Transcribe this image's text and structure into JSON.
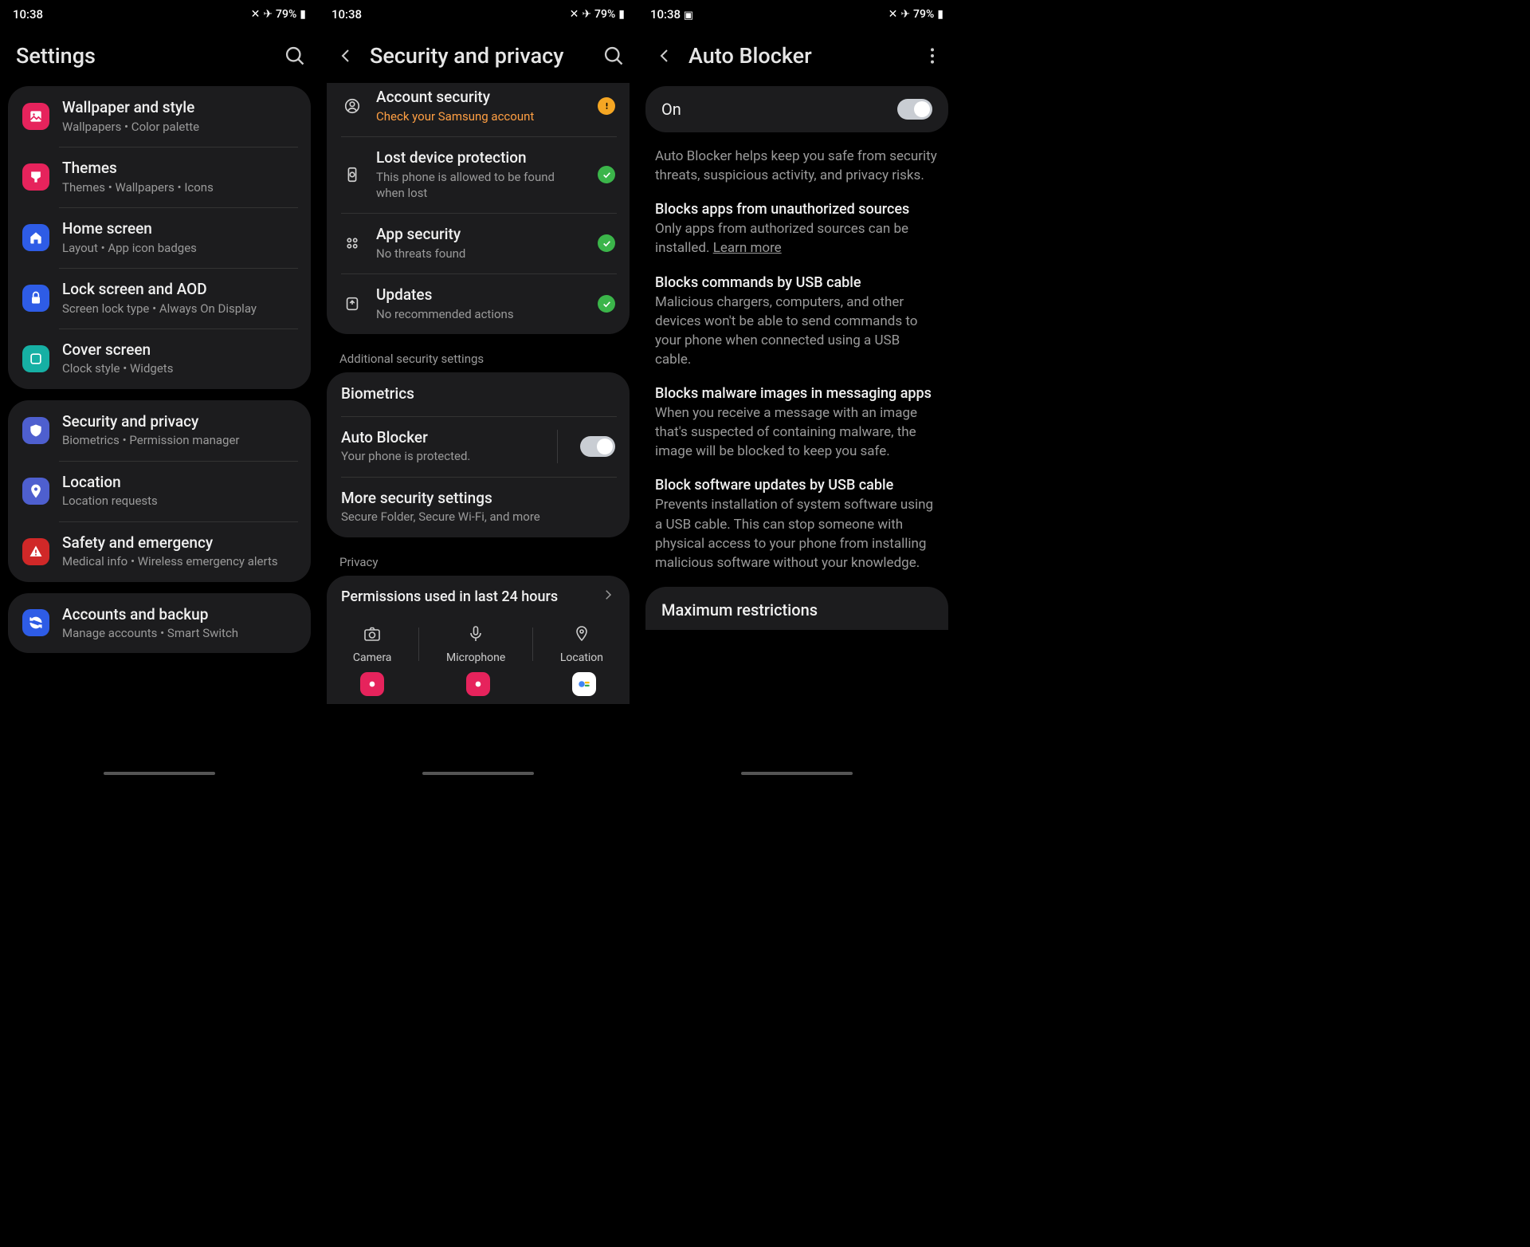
{
  "status": {
    "time": "10:38",
    "battery": "79%"
  },
  "pane1": {
    "title": "Settings",
    "groups": [
      [
        {
          "icon": "wallpaper",
          "color": "#e6235c",
          "title": "Wallpaper and style",
          "sub": "Wallpapers  •  Color palette"
        },
        {
          "icon": "themes",
          "color": "#e6235c",
          "title": "Themes",
          "sub": "Themes  •  Wallpapers  •  Icons"
        },
        {
          "icon": "home",
          "color": "#2e5ce6",
          "title": "Home screen",
          "sub": "Layout  •  App icon badges"
        },
        {
          "icon": "lock",
          "color": "#2e5ce6",
          "title": "Lock screen and AOD",
          "sub": "Screen lock type  •  Always On Display"
        },
        {
          "icon": "cover",
          "color": "#16b0a4",
          "title": "Cover screen",
          "sub": "Clock style  •  Widgets"
        }
      ],
      [
        {
          "icon": "shield",
          "color": "#4e5fcf",
          "title": "Security and privacy",
          "sub": "Biometrics  •  Permission manager"
        },
        {
          "icon": "location",
          "color": "#4e5fcf",
          "title": "Location",
          "sub": "Location requests"
        },
        {
          "icon": "emergency",
          "color": "#d02828",
          "title": "Safety and emergency",
          "sub": "Medical info  •  Wireless emergency alerts"
        }
      ],
      [
        {
          "icon": "sync",
          "color": "#2e5ce6",
          "title": "Accounts and backup",
          "sub": "Manage accounts  •  Smart Switch"
        }
      ]
    ]
  },
  "pane2": {
    "title": "Security and privacy",
    "top": [
      {
        "icon": "account",
        "title": "Account security",
        "sub": "Check your Samsung account",
        "subClass": "orange",
        "status": "warn"
      },
      {
        "icon": "find",
        "title": "Lost device protection",
        "sub": "This phone is allowed to be found when lost",
        "status": "ok"
      },
      {
        "icon": "apps",
        "title": "App security",
        "sub": "No threats found",
        "status": "ok"
      },
      {
        "icon": "update",
        "title": "Updates",
        "sub": "No recommended actions",
        "status": "ok"
      }
    ],
    "section1": "Additional security settings",
    "middle": [
      {
        "title": "Biometrics"
      },
      {
        "title": "Auto Blocker",
        "sub": "Your phone is protected.",
        "toggle": true
      },
      {
        "title": "More security settings",
        "sub": "Secure Folder, Secure Wi-Fi, and more"
      }
    ],
    "section2": "Privacy",
    "permTitle": "Permissions used in last 24 hours",
    "perms": [
      {
        "icon": "camera",
        "label": "Camera"
      },
      {
        "icon": "mic",
        "label": "Microphone"
      },
      {
        "icon": "loc",
        "label": "Location"
      }
    ]
  },
  "pane3": {
    "title": "Auto Blocker",
    "onLabel": "On",
    "intro": "Auto Blocker helps keep you safe from security threats, suspicious activity, and privacy risks.",
    "sections": [
      {
        "title": "Blocks apps from unauthorized sources",
        "body": "Only apps from authorized sources can be installed. ",
        "learn": "Learn more"
      },
      {
        "title": "Blocks commands by USB cable",
        "body": "Malicious chargers, computers, and other devices won't be able to send commands to your phone when connected using a USB cable."
      },
      {
        "title": "Blocks malware images in messaging apps",
        "body": "When you receive a message with an image that's suspected of containing malware, the image will be blocked to keep you safe."
      },
      {
        "title": "Block software updates by USB cable",
        "body": "Prevents installation of system software using a USB cable. This can stop someone with physical access to your phone from installing malicious software without your knowledge."
      }
    ],
    "maxTitle": "Maximum restrictions"
  }
}
